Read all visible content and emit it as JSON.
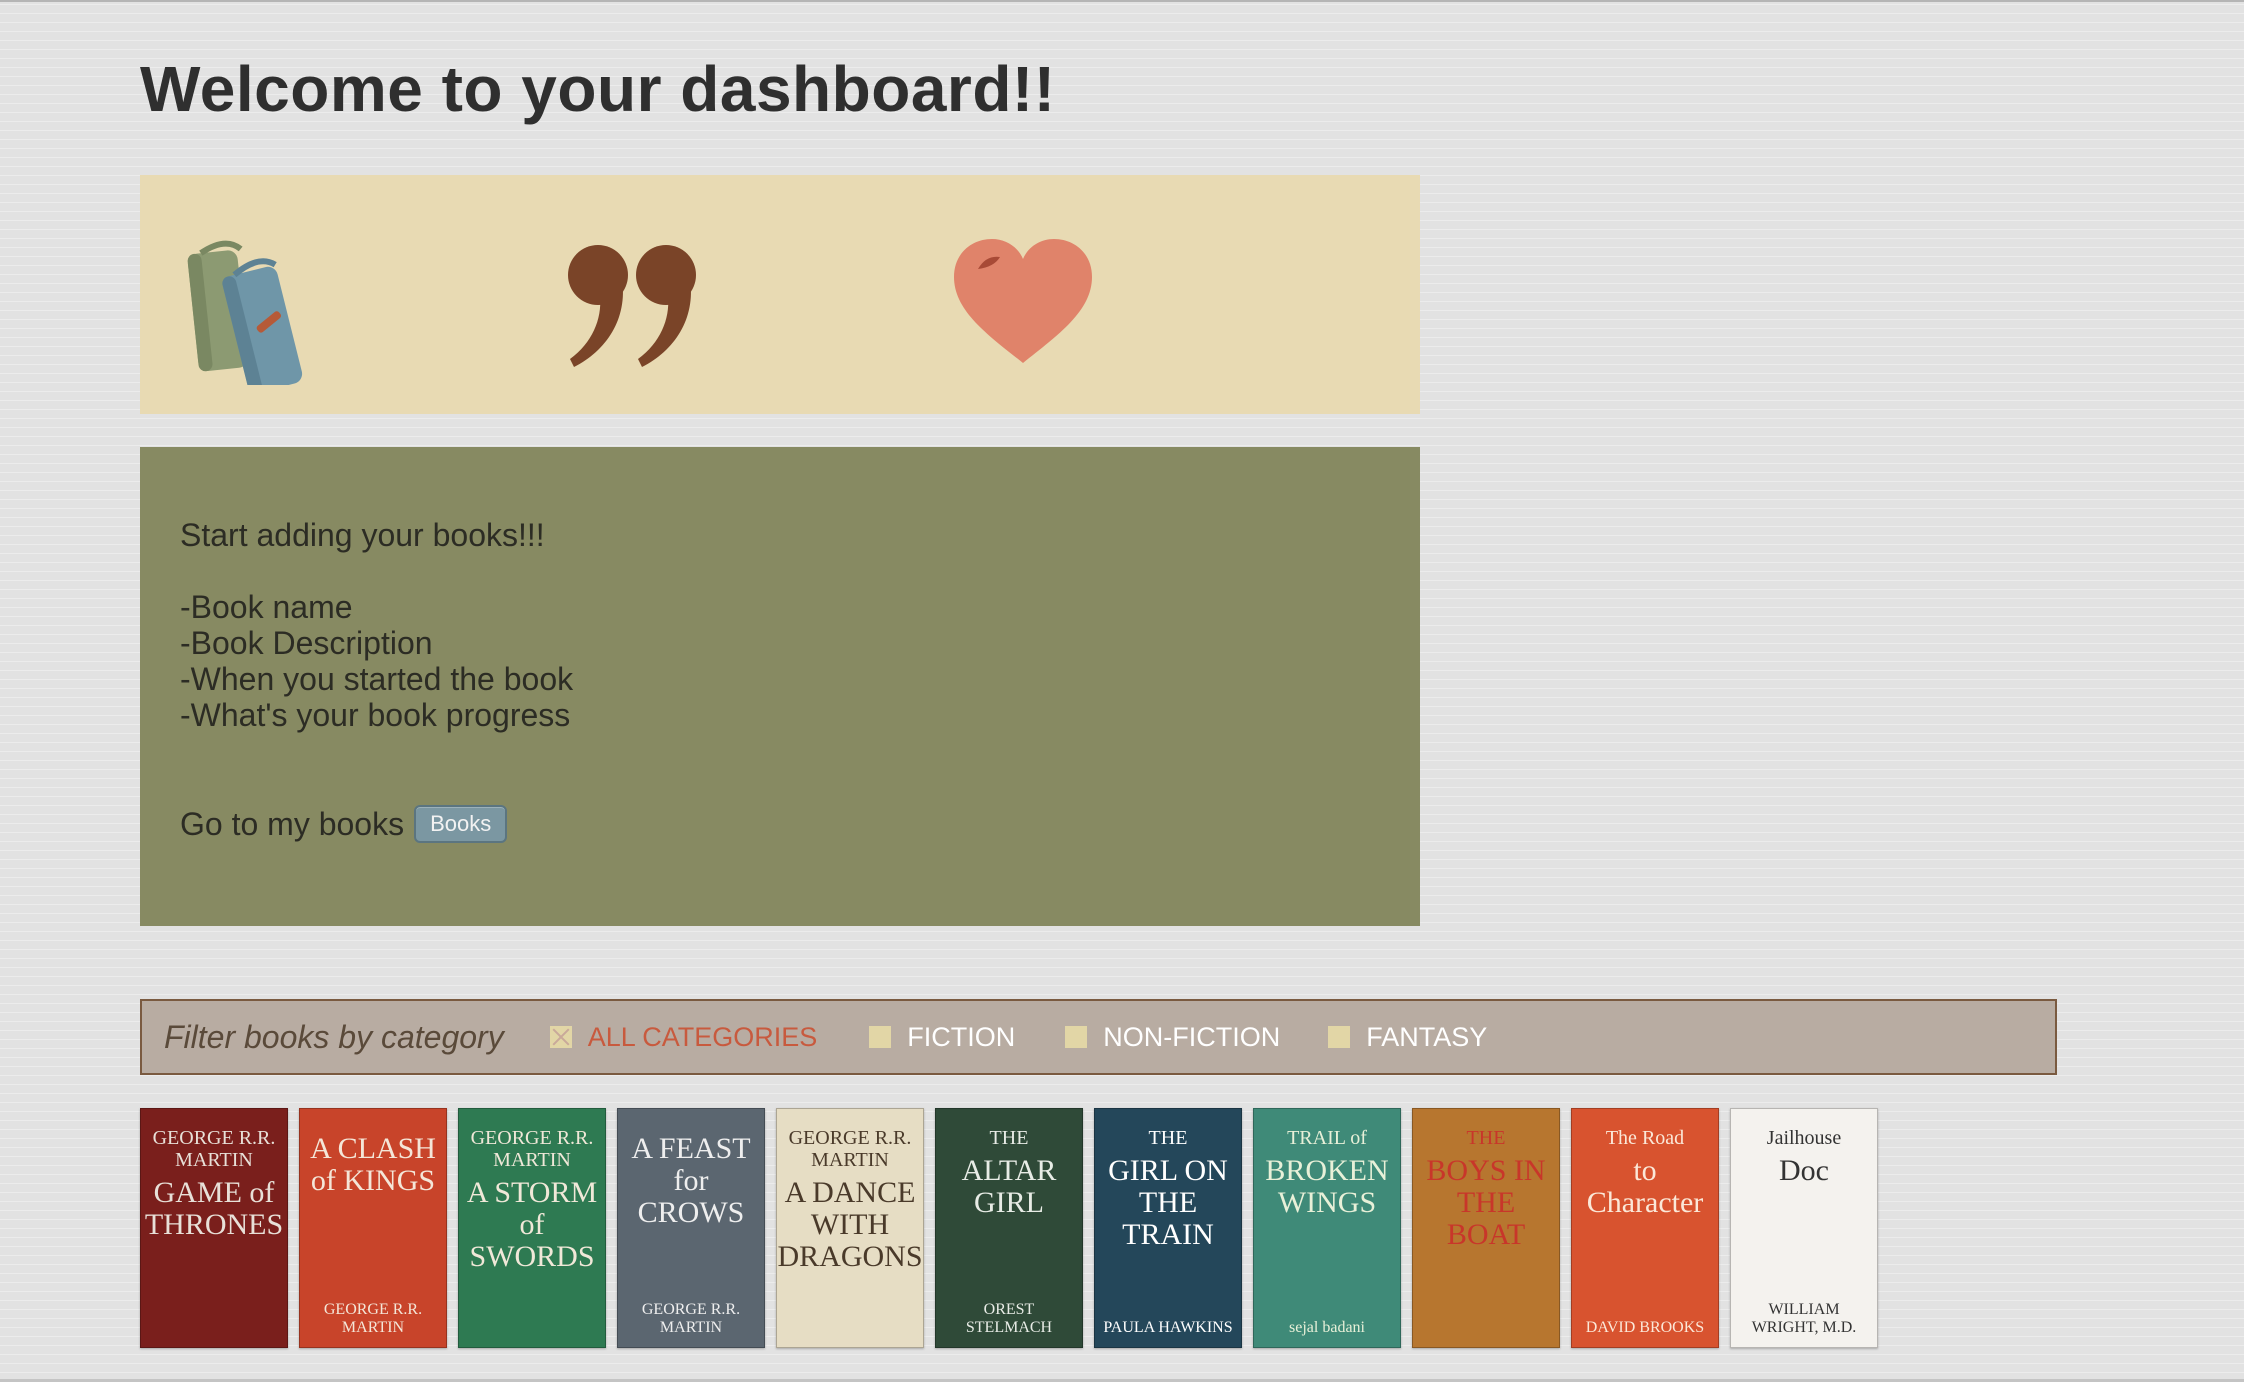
{
  "page": {
    "title": "Welcome to your dashboard!!"
  },
  "icons": [
    {
      "name": "books-icon",
      "color_green": "#8c9a72",
      "color_blue": "#6f96a8"
    },
    {
      "name": "quote-icon",
      "color": "#7a4428"
    },
    {
      "name": "heart-icon",
      "color": "#e0836a"
    }
  ],
  "info": {
    "intro": "Start adding your books!!!",
    "items": [
      "-Book name",
      "-Book Description",
      "-When you started the book",
      "-What's your book progress"
    ],
    "goto_label": "Go to my books",
    "books_button": "Books"
  },
  "filter": {
    "label": "Filter books by category",
    "categories": [
      {
        "label": "ALL CATEGORIES",
        "active": true
      },
      {
        "label": "FICTION",
        "active": false
      },
      {
        "label": "NON-FICTION",
        "active": false
      },
      {
        "label": "FANTASY",
        "active": false
      }
    ]
  },
  "books": [
    {
      "line1": "GEORGE R.R. MARTIN",
      "line2": "GAME of THRONES",
      "line3": "",
      "bg": "#7a1f1c",
      "fg": "#e8e0d8"
    },
    {
      "line1": "",
      "line2": "A CLASH of KINGS",
      "line3": "GEORGE R.R. MARTIN",
      "bg": "#c8442a",
      "fg": "#f4e6d8"
    },
    {
      "line1": "GEORGE R.R. MARTIN",
      "line2": "A STORM of SWORDS",
      "line3": "",
      "bg": "#2e7a52",
      "fg": "#f0e8d8"
    },
    {
      "line1": "",
      "line2": "A FEAST for CROWS",
      "line3": "GEORGE R.R. MARTIN",
      "bg": "#5b6670",
      "fg": "#eeeeee"
    },
    {
      "line1": "GEORGE R.R. MARTIN",
      "line2": "A DANCE WITH DRAGONS",
      "line3": "",
      "bg": "#e6ddc4",
      "fg": "#4a3a2a"
    },
    {
      "line1": "THE",
      "line2": "ALTAR GIRL",
      "line3": "OREST STELMACH",
      "bg": "#2f4a38",
      "fg": "#e8ece6"
    },
    {
      "line1": "THE",
      "line2": "GIRL ON THE TRAIN",
      "line3": "PAULA HAWKINS",
      "bg": "#24475a",
      "fg": "#ffffff"
    },
    {
      "line1": "TRAIL of",
      "line2": "BROKEN WINGS",
      "line3": "sejal badani",
      "bg": "#3f8a78",
      "fg": "#e8f0d8"
    },
    {
      "line1": "THE",
      "line2": "BOYS IN THE BOAT",
      "line3": "",
      "bg": "#b7762f",
      "fg": "#c8362a"
    },
    {
      "line1": "The Road",
      "line2": "to Character",
      "line3": "DAVID BROOKS",
      "bg": "#d8532f",
      "fg": "#fbe8d8"
    },
    {
      "line1": "Jailhouse",
      "line2": "Doc",
      "line3": "WILLIAM WRIGHT, M.D.",
      "bg": "#f4f2ee",
      "fg": "#333333"
    }
  ]
}
